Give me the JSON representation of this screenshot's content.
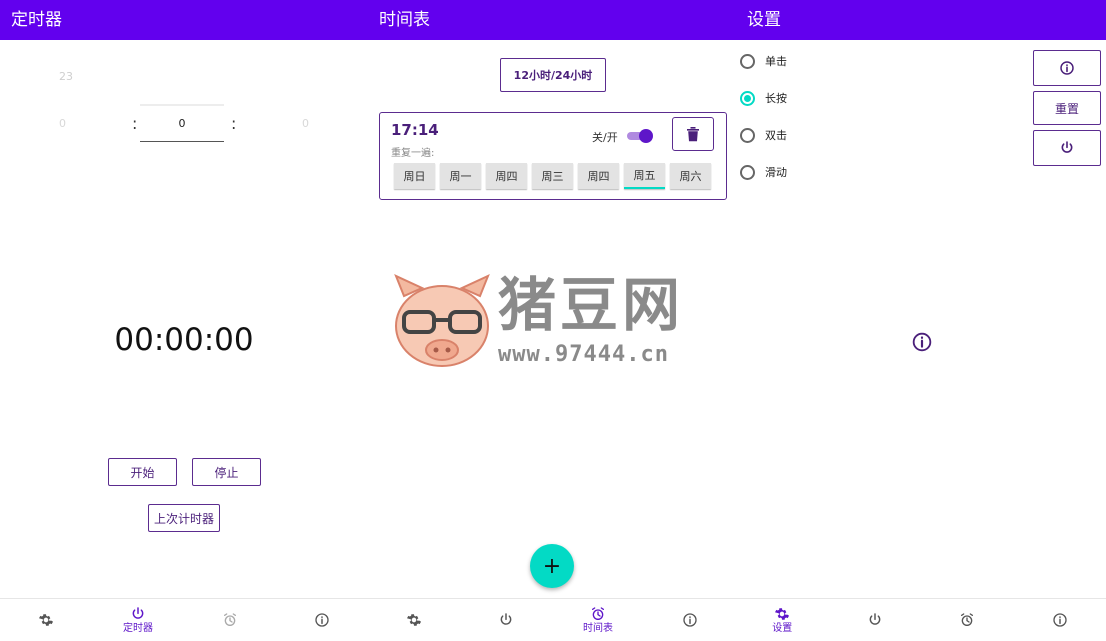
{
  "screen1": {
    "title": "定时器",
    "picker_top": [
      "23",
      "",
      ""
    ],
    "picker_mid": [
      "0",
      "",
      "0"
    ],
    "picker_value": "0",
    "separator": ":",
    "time_display": "00:00:00",
    "start_label": "开始",
    "stop_label": "停止",
    "last_timer_label": "上次计时器",
    "nav": [
      {
        "icon": "gear-icon",
        "label": ""
      },
      {
        "icon": "power-icon",
        "label": "定时器"
      },
      {
        "icon": "alarm-clock-icon",
        "label": ""
      },
      {
        "icon": "info-icon",
        "label": ""
      }
    ]
  },
  "screen2": {
    "title": "时间表",
    "format_toggle_label": "12小时/24小时",
    "alarm": {
      "time": "17:14",
      "repeat_label": "重复一遍:",
      "switch_label": "关/开",
      "switch_on": true,
      "days": [
        "周日",
        "周一",
        "周四",
        "周三",
        "周四",
        "周五",
        "周六"
      ]
    },
    "fab_label": "+",
    "nav": [
      {
        "icon": "gear-icon",
        "label": ""
      },
      {
        "icon": "power-icon",
        "label": ""
      },
      {
        "icon": "alarm-clock-icon",
        "label": "时间表"
      },
      {
        "icon": "info-icon",
        "label": ""
      }
    ]
  },
  "screen3": {
    "title": "设置",
    "options": [
      {
        "label": "单击",
        "selected": false
      },
      {
        "label": "长按",
        "selected": true
      },
      {
        "label": "双击",
        "selected": false
      },
      {
        "label": "滑动",
        "selected": false
      }
    ],
    "reset_label": "重置",
    "nav": [
      {
        "icon": "gear-icon",
        "label": "设置"
      },
      {
        "icon": "power-icon",
        "label": ""
      },
      {
        "icon": "alarm-clock-icon",
        "label": ""
      },
      {
        "icon": "info-icon",
        "label": ""
      }
    ]
  },
  "watermark": {
    "text": "猪豆网",
    "url": "www.97444.cn"
  },
  "colors": {
    "primary": "#6200ee",
    "accent": "#03dac5",
    "outline": "#5b2c8f"
  }
}
